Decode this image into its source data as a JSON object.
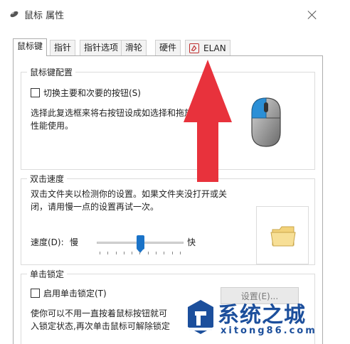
{
  "window": {
    "title": "鼠标 属性",
    "icon": "mouse-icon",
    "close_icon": "close-icon"
  },
  "tabs": [
    {
      "label": "鼠标键",
      "active": true
    },
    {
      "label": "指针"
    },
    {
      "label": "指针选项"
    },
    {
      "label": "滑轮"
    },
    {
      "label": "硬件"
    },
    {
      "label": "ELAN",
      "icon": "elan-logo-icon"
    }
  ],
  "button_config": {
    "title": "鼠标键配置",
    "switch_checkbox_label": "切换主要和次要的按钮(S)",
    "switch_checked": false,
    "description_line1": "选择此复选框来将右按钮设成如选择和拖放",
    "description_line2": "性能使用。"
  },
  "double_click": {
    "title": "双击速度",
    "description_line1": "双击文件夹以检测你的设置。如果文件夹没打开或关",
    "description_line2": "闭，请用慢一点的设置再试一次。",
    "speed_label": "速度(D):",
    "slow_label": "慢",
    "fast_label": "快",
    "speed_level": 0.5
  },
  "click_lock": {
    "title": "单击锁定",
    "checkbox_label": "启用单击锁定(T)",
    "checked": false,
    "description_line1": "使你可以不用一直按着鼠标按钮就可",
    "description_line2": "入锁定状态,再次单击鼠标可解除锁定",
    "settings_button": "设置(E)..."
  },
  "watermark": {
    "title": "系统之城",
    "subtitle": "xitong86.com"
  },
  "colors": {
    "accent": "#1a73c8",
    "arrow": "#e8323c",
    "watermark": "#1c4f9c"
  }
}
